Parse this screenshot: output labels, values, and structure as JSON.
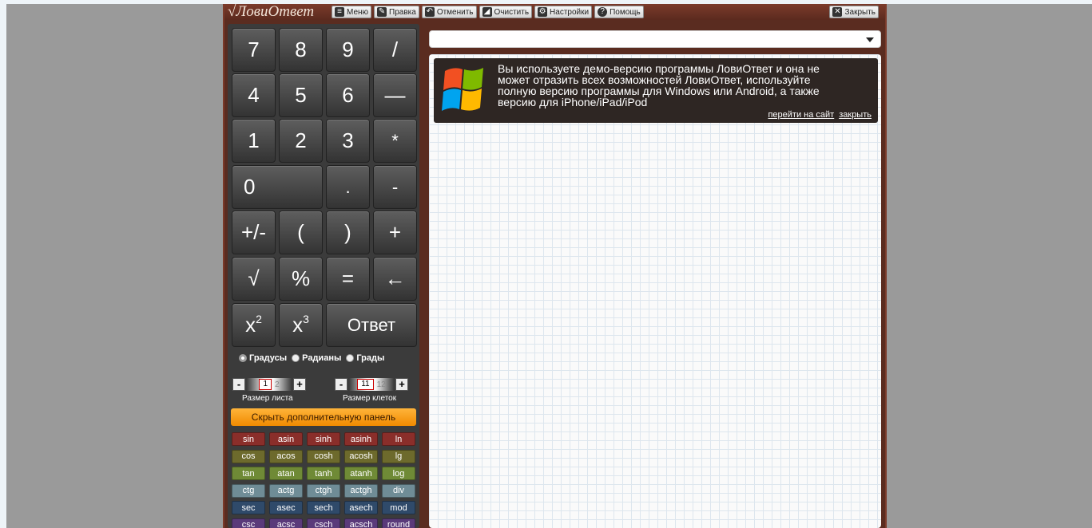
{
  "app": {
    "logo": "√ЛовиОтвет"
  },
  "toolbar": {
    "menu": "Меню",
    "edit": "Правка",
    "undo": "Отменить",
    "clear": "Очистить",
    "settings": "Настройки",
    "help": "Помощь",
    "close": "Закрыть"
  },
  "keypad": {
    "k7": "7",
    "k8": "8",
    "k9": "9",
    "kdiv": "/",
    "k4": "4",
    "k5": "5",
    "k6": "6",
    "kdash": "—",
    "k1": "1",
    "k2": "2",
    "k3": "3",
    "kmul": "*",
    "k0": "0",
    "kdot": ".",
    "kminus": "-",
    "kpm": "+/-",
    "klp": "(",
    "krp": ")",
    "kplus": "+",
    "ksqrt": "√",
    "kpct": "%",
    "keq": "=",
    "kback": "←",
    "kx": "x",
    "sup2": "2",
    "sup3": "3",
    "answer": "Ответ"
  },
  "angle_units": {
    "options": [
      "Градусы",
      "Радианы",
      "Грады"
    ],
    "selected": "Градусы"
  },
  "sheet_size": {
    "label": "Размер листа",
    "current": "1",
    "next": "2"
  },
  "cell_size": {
    "label": "Размер клеток",
    "current": "11",
    "next": "12"
  },
  "toggle_panel_label": "Скрыть дополнительную панель",
  "functions": {
    "rows": [
      [
        "sin",
        "asin",
        "sinh",
        "asinh",
        "ln"
      ],
      [
        "cos",
        "acos",
        "cosh",
        "acosh",
        "lg"
      ],
      [
        "tan",
        "atan",
        "tanh",
        "atanh",
        "log"
      ],
      [
        "ctg",
        "actg",
        "ctgh",
        "actgh",
        "div"
      ],
      [
        "sec",
        "asec",
        "sech",
        "asech",
        "mod"
      ],
      [
        "csc",
        "acsc",
        "csch",
        "acsch",
        "round"
      ]
    ],
    "row_colors": [
      "#8a2e2a",
      "#6d6a2c",
      "#6f8a36",
      "#6f8c96",
      "#2f4a6a",
      "#5a3a7a"
    ]
  },
  "expression_dropdown": {
    "value": ""
  },
  "promo": {
    "text": "Вы используете демо-версию программы ЛовиОтвет и она не может отразить всех возможностей ЛовиОтвет, используйте полную версию программы для Windows или Android, а также версию для iPhone/iPad/iPod",
    "link_site": "перейти на сайт",
    "link_close": "закрыть"
  }
}
